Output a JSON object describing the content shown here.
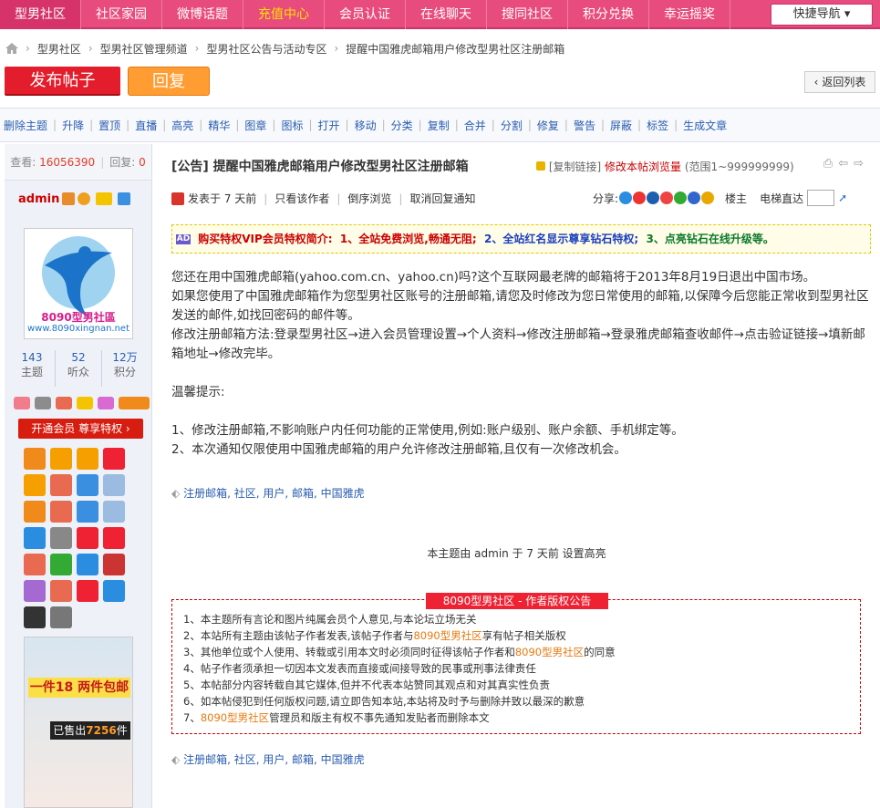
{
  "topnav": {
    "items": [
      "型男社区",
      "社区家园",
      "微博话题",
      "充值中心",
      "会员认证",
      "在线聊天",
      "搜同社区",
      "积分兑换",
      "幸运摇奖"
    ],
    "quick": "快捷导航"
  },
  "breadcrumb": [
    "型男社区",
    "型男社区管理频道",
    "型男社区公告与活动专区",
    "提醒中国雅虎邮箱用户修改型男社区注册邮箱"
  ],
  "buttons": {
    "post": "发布帖子",
    "reply": "回复",
    "back": "返回列表"
  },
  "modtools": [
    "删除主题",
    "升降",
    "置顶",
    "直播",
    "高亮",
    "精华",
    "图章",
    "图标",
    "打开",
    "移动",
    "分类",
    "复制",
    "合并",
    "分割",
    "修复",
    "警告",
    "屏蔽",
    "标签",
    "生成文章"
  ],
  "sidebar": {
    "views_label": "查看:",
    "views": "16056390",
    "replies_label": "回复:",
    "replies": "0",
    "username": "admin",
    "avatar_text": "8090型男社區",
    "avatar_url": "www.8090xingnan.net",
    "topics": "143",
    "topics_label": "主题",
    "fans": "52",
    "fans_label": "听众",
    "points": "12万",
    "points_label": "积分",
    "vip_button": "开通会员 尊享特权 ›",
    "ad_line1": "一件18 两件包邮",
    "ad_sold_prefix": "已售出",
    "ad_sold": "7256",
    "ad_sold_suffix": "件"
  },
  "post": {
    "title": "[公告] 提醒中国雅虎邮箱用户修改型男社区注册邮箱",
    "copy_link": "[复制链接]",
    "modify": "修改本帖浏览量",
    "range": "(范围1~999999999)",
    "posted": "发表于 7 天前",
    "only_author": "只看该作者",
    "reverse": "倒序浏览",
    "cancel_notify": "取消回复通知",
    "share": "分享:",
    "floor": "楼主",
    "elevator": "电梯直达",
    "vip_notice": {
      "lead": "购买特权VIP会员特权简介:",
      "p1": "1、全站免费浏览,畅通无阻;",
      "p2": "2、全站红名显示尊享钻石特权;",
      "p3": "3、点亮钻石在线升级等。"
    },
    "body": [
      "您还在用中国雅虎邮箱(yahoo.com.cn、yahoo.cn)吗?这个互联网最老牌的邮箱将于2013年8月19日退出中国市场。",
      "如果您使用了中国雅虎邮箱作为您型男社区账号的注册邮箱,请您及时修改为您日常使用的邮箱,以保障今后您能正常收到型男社区发送的邮件,如找回密码的邮件等。",
      "修改注册邮箱方法:登录型男社区→进入会员管理设置→个人资料→修改注册邮箱→登录雅虎邮箱查收邮件→点击验证链接→填新邮箱地址→修改完毕。",
      "温馨提示:",
      "1、修改注册邮箱,不影响账户内任何功能的正常使用,例如:账户级别、账户余额、手机绑定等。",
      "2、本次通知仅限使用中国雅虎邮箱的用户允许修改注册邮箱,且仅有一次修改机会。"
    ],
    "tags": "注册邮箱, 社区, 用户, 邮箱, 中国雅虎",
    "highlight": "本主题由 admin 于 7 天前 设置高亮"
  },
  "copyright": {
    "header": "8090型男社区 - 作者版权公告",
    "brand": "8090型男社区",
    "lines": [
      {
        "a": "1、本主题所有言论和图片纯属会员个人意见,与本论坛立场无关",
        "b": "",
        "c": ""
      },
      {
        "a": "2、本站所有主题由该帖子作者发表,该帖子作者与",
        "b": "8090型男社区",
        "c": "享有帖子相关版权"
      },
      {
        "a": "3、其他单位或个人使用、转载或引用本文时必须同时征得该帖子作者和",
        "b": "8090型男社区",
        "c": "的同意"
      },
      {
        "a": "4、帖子作者须承担一切因本文发表而直接或间接导致的民事或刑事法律责任",
        "b": "",
        "c": ""
      },
      {
        "a": "5、本帖部分内容转载自其它媒体,但并不代表本站赞同其观点和对其真实性负责",
        "b": "",
        "c": ""
      },
      {
        "a": "6、如本帖侵犯到任何版权问题,请立即告知本站,本站将及时予与删除并致以最深的歉意",
        "b": "",
        "c": ""
      },
      {
        "a": "7、",
        "b": "8090型男社区",
        "c": "管理员和版主有权不事先通知发贴者而删除本文"
      }
    ]
  }
}
